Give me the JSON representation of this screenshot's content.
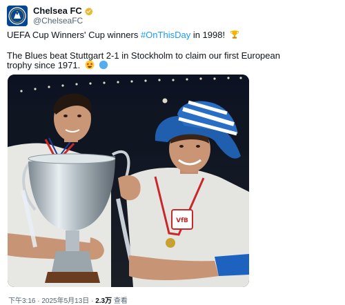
{
  "author": {
    "display_name": "Chelsea FC",
    "handle": "@ChelseaFC",
    "avatar_icon": "chelsea-crest-icon",
    "verified_icon": "verified-badge-icon",
    "brand_color": "#034694",
    "verified_color": "#e8b830"
  },
  "tweet": {
    "line1_prefix": "UEFA Cup Winners' Cup winners ",
    "hashtag": "#OnThisDay",
    "line1_suffix": " in 1998!",
    "line1_emoji": "trophy-icon",
    "line2": "The Blues beat Stuttgart 2-1 in Stockholm to claim our first European",
    "line3": "trophy since 1971.",
    "line3_emojis": [
      "star-struck-face-icon",
      "blue-circle-icon"
    ],
    "hashtag_color": "#1d9bf0"
  },
  "media": {
    "image_icon": "trophy-celebration-photo"
  },
  "meta": {
    "time": "下午3:16",
    "separator": "·",
    "date": "2025年5月13日",
    "views_count": "2.3万",
    "views_label": "查看"
  }
}
